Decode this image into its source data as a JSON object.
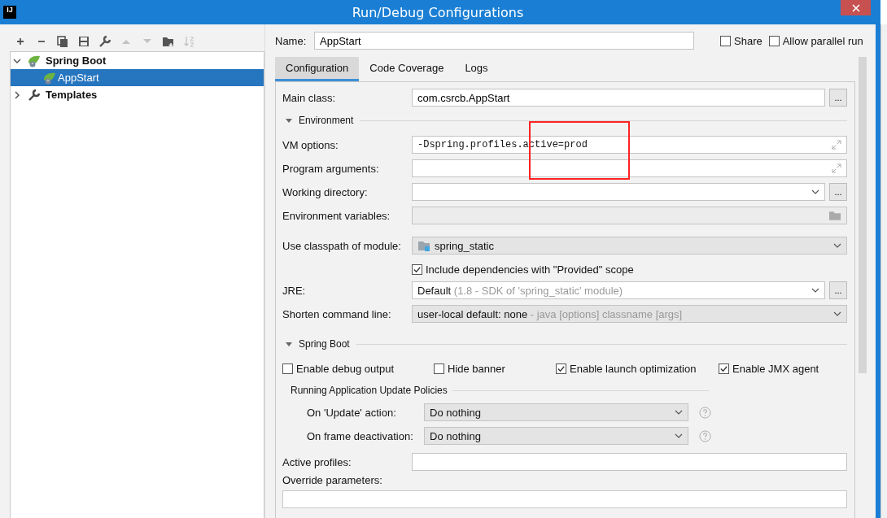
{
  "window": {
    "title": "Run/Debug Configurations",
    "logo": "IJ"
  },
  "toolbar": [
    {
      "kind": "add",
      "disabled": false
    },
    {
      "kind": "remove",
      "disabled": false
    },
    {
      "kind": "copy",
      "disabled": false
    },
    {
      "kind": "save",
      "disabled": false
    },
    {
      "kind": "wrench",
      "disabled": false
    },
    {
      "kind": "up",
      "disabled": true
    },
    {
      "kind": "down",
      "disabled": true
    },
    {
      "kind": "folder",
      "disabled": false
    },
    {
      "kind": "sort",
      "disabled": true
    }
  ],
  "tree": [
    {
      "label": "Spring Boot",
      "kind": "spring",
      "expanded": true,
      "selected": false,
      "children": [
        {
          "label": "AppStart",
          "kind": "spring",
          "selected": true
        }
      ]
    },
    {
      "label": "Templates",
      "kind": "wrench",
      "expanded": false,
      "selected": false
    }
  ],
  "name": {
    "label": "Name:",
    "value": "AppStart"
  },
  "options": [
    {
      "label": "Share",
      "checked": false
    },
    {
      "label": "Allow parallel run",
      "checked": false
    }
  ],
  "tabs": [
    {
      "label": "Configuration",
      "selected": true
    },
    {
      "label": "Code Coverage",
      "selected": false
    },
    {
      "label": "Logs",
      "selected": false
    }
  ],
  "main_class": {
    "label": "Main class:",
    "value": "com.csrcb.AppStart",
    "browse": "..."
  },
  "environment": {
    "title": "Environment",
    "expanded": true,
    "fields": [
      {
        "label": "VM options:",
        "value": "-Dspring.profiles.active=prod",
        "kind": "expand"
      },
      {
        "label": "Program arguments:",
        "kind": "expand"
      },
      {
        "label": "Working directory:",
        "kind": "combo",
        "browse": "..."
      },
      {
        "label": "Environment variables:",
        "kind": "folder"
      }
    ]
  },
  "classpath": {
    "label": "Use classpath of module:",
    "value": "spring_static"
  },
  "include_provided": {
    "label": "Include dependencies with \"Provided\" scope",
    "checked": true
  },
  "jre": {
    "label": "JRE:",
    "value": "Default",
    "hint": "(1.8 - SDK of 'spring_static' module)",
    "browse": "..."
  },
  "shorten": {
    "label": "Shorten command line:",
    "value": "user-local default: none",
    "hint": "- java [options] classname [args]"
  },
  "spring_boot": {
    "title": "Spring Boot",
    "expanded": true,
    "options": [
      {
        "label": "Enable debug output",
        "checked": false
      },
      {
        "label": "Hide banner",
        "checked": false
      },
      {
        "label": "Enable launch optimization",
        "checked": true
      },
      {
        "label": "Enable JMX agent",
        "checked": true
      }
    ],
    "policies": {
      "title": "Running Application Update Policies",
      "items": [
        {
          "label": "On 'Update' action:",
          "value": "Do nothing"
        },
        {
          "label": "On frame deactivation:",
          "value": "Do nothing"
        }
      ]
    }
  },
  "active_profiles": {
    "label": "Active profiles:"
  },
  "override": {
    "label": "Override parameters:"
  }
}
